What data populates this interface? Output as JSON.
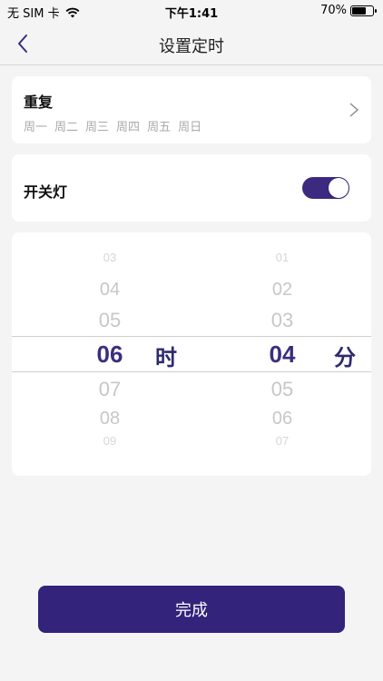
{
  "status_bar": {
    "carrier": "无 SIM 卡",
    "time": "下午1:41",
    "battery_text": "70%",
    "battery_level": 0.7
  },
  "nav": {
    "title": "设置定时",
    "back_icon": "chevron-left-icon"
  },
  "repeat": {
    "title": "重复",
    "days": [
      "周一",
      "周二",
      "周三",
      "周四",
      "周五",
      "周日"
    ],
    "chevron_icon": "chevron-right-icon"
  },
  "light": {
    "label": "开关灯",
    "enabled": true
  },
  "picker": {
    "hour": {
      "above": [
        "03",
        "04",
        "05"
      ],
      "selected": "06",
      "below": [
        "07",
        "08",
        "09"
      ],
      "unit": "时"
    },
    "minute": {
      "above": [
        "01",
        "02",
        "03"
      ],
      "selected": "04",
      "below": [
        "05",
        "06",
        "07"
      ],
      "unit": "分"
    }
  },
  "done_button": {
    "label": "完成"
  },
  "colors": {
    "accent": "#33237a",
    "background": "#f4f4f4",
    "muted_text": "#aaaaaa"
  }
}
